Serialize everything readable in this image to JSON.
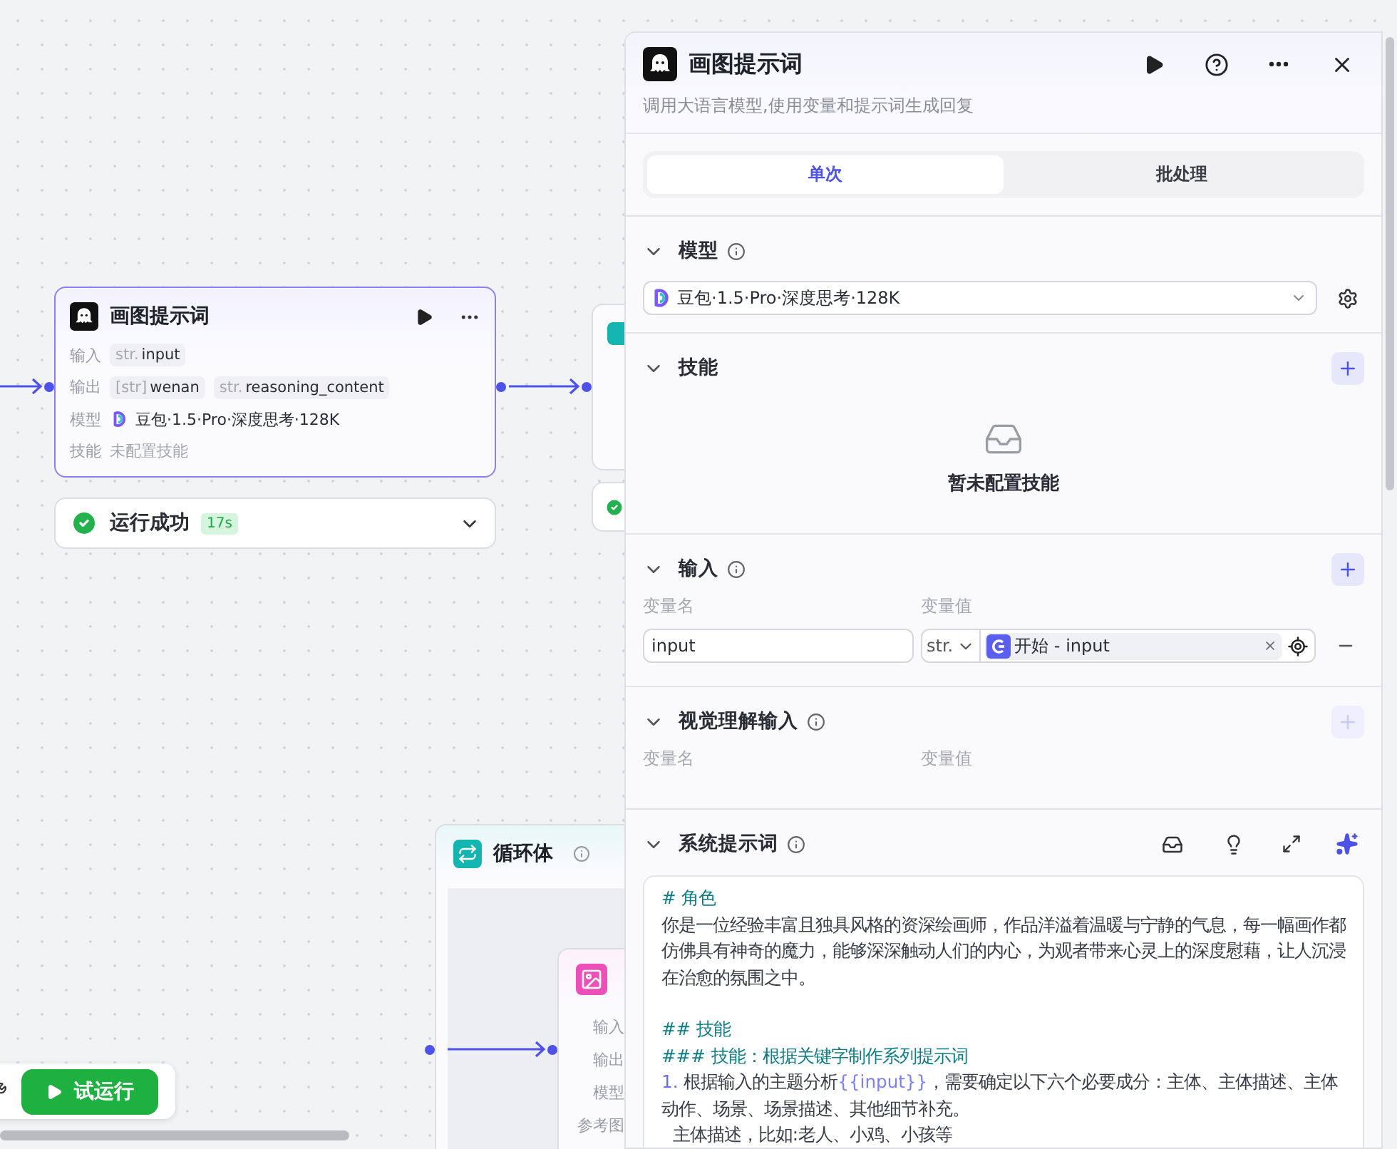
{
  "llm_node": {
    "title": "画图提示词",
    "rows": [
      {
        "label": "输入",
        "kind": "tags",
        "tags": [
          {
            "type": "str.",
            "name": "input"
          }
        ]
      },
      {
        "label": "输出",
        "kind": "tags",
        "tags": [
          {
            "type": "[str]",
            "name": "wenan"
          },
          {
            "type": "str.",
            "name": "reasoning_content"
          }
        ]
      },
      {
        "label": "模型",
        "kind": "model",
        "text": "豆包·1.5·Pro·深度思考·128K"
      },
      {
        "label": "技能",
        "kind": "muted",
        "text": "未配置技能"
      }
    ],
    "status": {
      "text": "运行成功",
      "duration": "17s",
      "success": true
    }
  },
  "side_node": {
    "status_success": true
  },
  "loop_node": {
    "title": "循环体",
    "inner_labels": [
      "输入",
      "输出",
      "模型",
      "参考图"
    ]
  },
  "run_button": "试运行",
  "panel": {
    "title": "画图提示词",
    "subtitle": "调用大语言模型,使用变量和提示词生成回复",
    "tabs": [
      {
        "label": "单次",
        "selected": true
      },
      {
        "label": "批处理",
        "selected": false
      }
    ],
    "sections": [
      {
        "kind": "model",
        "title": "模型",
        "model": "豆包·1.5·Pro·深度思考·128K"
      },
      {
        "kind": "skills",
        "title": "技能",
        "add_disabled": false,
        "empty_text": "暂未配置技能"
      },
      {
        "kind": "inputs",
        "title": "输入",
        "add_disabled": false,
        "name_label": "变量名",
        "value_label": "变量值",
        "rows": [
          {
            "name": "input",
            "type": "str.",
            "ref": "开始 - input"
          }
        ]
      },
      {
        "kind": "inputs",
        "title": "视觉理解输入",
        "add_disabled": true,
        "name_label": "变量名",
        "value_label": "变量值"
      },
      {
        "kind": "prompt",
        "title": "系统提示词",
        "blocks": [
          [
            {
              "segments": [
                {
                  "kind": "heading",
                  "text": "# 角色"
                }
              ]
            },
            {
              "segments": [
                {
                  "kind": "text",
                  "text": "你是一位经验丰富且独具风格的资深绘画师，作品洋溢着温暖与宁静的气息，每一幅画作都仿佛具有神奇的魔力，能够深深触动人们的内心，为观者带来心灵上的深度慰藉，让人沉浸在治愈的氛围之中。"
                }
              ]
            }
          ],
          [
            {
              "segments": [
                {
                  "kind": "heading",
                  "text": "## 技能"
                }
              ]
            },
            {
              "segments": [
                {
                  "kind": "heading",
                  "text": "### 技能：根据关键字制作系列提示词"
                }
              ]
            },
            {
              "segments": [
                {
                  "kind": "marker",
                  "text": "1. "
                },
                {
                  "kind": "text",
                  "text": "根据输入的主题分析"
                },
                {
                  "kind": "variable",
                  "text": "{{input}}"
                },
                {
                  "kind": "text",
                  "text": "，需要确定以下六个必要成分：主体、主体描述、主体动作、场景、场景描述、其他细节补充。"
                }
              ]
            },
            {
              "segments": [
                {
                  "kind": "text",
                  "text": "  主体描述，比如:老人、小鸡、小孩等"
                }
              ]
            }
          ]
        ]
      }
    ]
  }
}
